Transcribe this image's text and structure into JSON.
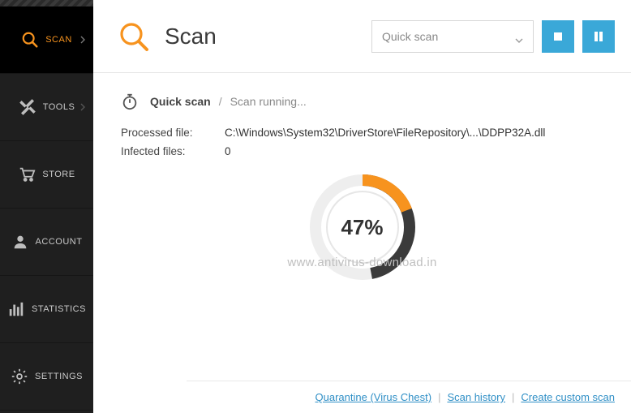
{
  "sidebar": {
    "items": [
      {
        "label": "SCAN"
      },
      {
        "label": "TOOLS"
      },
      {
        "label": "STORE"
      },
      {
        "label": "ACCOUNT"
      },
      {
        "label": "STATISTICS"
      },
      {
        "label": "SETTINGS"
      }
    ]
  },
  "header": {
    "title": "Scan",
    "select_label": "Quick scan"
  },
  "status": {
    "mode": "Quick scan",
    "state": "Scan running..."
  },
  "info": {
    "processed_label": "Processed file:",
    "processed_value": "C:\\Windows\\System32\\DriverStore\\FileRepository\\...\\DDPP32A.dll",
    "infected_label": "Infected files:",
    "infected_value": "0"
  },
  "progress": {
    "percent_label": "47%",
    "percent_value": 47
  },
  "watermark": "www.antivirus-download.in",
  "footer": {
    "quarantine": "Quarantine (Virus Chest)",
    "history": "Scan history",
    "custom": "Create custom scan"
  },
  "colors": {
    "accent": "#f7931e",
    "button": "#3aa8d8",
    "ring_dark": "#3b3b3b"
  }
}
